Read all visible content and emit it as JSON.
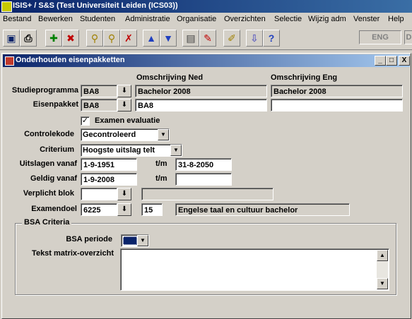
{
  "app": {
    "title": "ISIS+ / S&S  (Test Universiteit Leiden (ICS03))"
  },
  "menu": [
    "Bestand",
    "Bewerken",
    "Studenten",
    "Administratie",
    "Organisatie",
    "Overzichten",
    "Selectie",
    "Wijzig adm",
    "Venster",
    "Help"
  ],
  "toolbar": {
    "icons": [
      "save-icon",
      "print-icon",
      "add-icon",
      "delete-icon",
      "lov-icon",
      "query-icon",
      "clear-query-icon",
      "up-arrow-icon",
      "down-arrow-icon",
      "screen-icon",
      "edit-icon",
      "notes-icon",
      "sort-icon",
      "help-icon"
    ],
    "lang1": "ENG",
    "lang2": "D"
  },
  "window": {
    "title": "Onderhouden eisenpakketten",
    "controls": [
      "_",
      "□",
      "X"
    ]
  },
  "form": {
    "hdr_ned": "Omschrijving Ned",
    "hdr_eng": "Omschrijving Eng",
    "studieprogramma_label": "Studieprogramma",
    "studieprogramma_code": "BA8",
    "studieprogramma_ned": "Bachelor 2008",
    "studieprogramma_eng": "Bachelor  2008",
    "eisenpakket_label": "Eisenpakket",
    "eisenpakket_code": "BA8",
    "eisenpakket_ned": "BA8",
    "eisenpakket_eng": "",
    "examen_evaluatie_label": "Examen evaluatie",
    "examen_evaluatie_checked": "✓",
    "controlekode_label": "Controlekode",
    "controlekode_value": "Gecontroleerd",
    "criterium_label": "Criterium",
    "criterium_value": "Hoogste uitslag telt",
    "uitslagen_vanaf_label": "Uitslagen vanaf",
    "uitslagen_vanaf_value": "1-9-1951",
    "tm_label": "t/m",
    "uitslagen_tm_value": "31-8-2050",
    "geldig_vanaf_label": "Geldig vanaf",
    "geldig_vanaf_value": "1-9-2008",
    "geldig_tm_value": "",
    "verplicht_blok_label": "Verplicht blok",
    "verplicht_blok_value": "",
    "verplicht_blok_desc": "",
    "examendoel_label": "Examendoel",
    "examendoel_code": "6225",
    "examendoel_num": "15",
    "examendoel_desc": "Engelse taal en cultuur bachelor",
    "lov_glyph": "⬇",
    "bsa": {
      "title": "BSA Criteria",
      "periode_label": "BSA periode",
      "tekst_label": "Tekst matrix-overzicht",
      "tekst_value": ""
    }
  },
  "colors": {
    "titlebar": "#0a246a",
    "face": "#d4d0c8"
  }
}
